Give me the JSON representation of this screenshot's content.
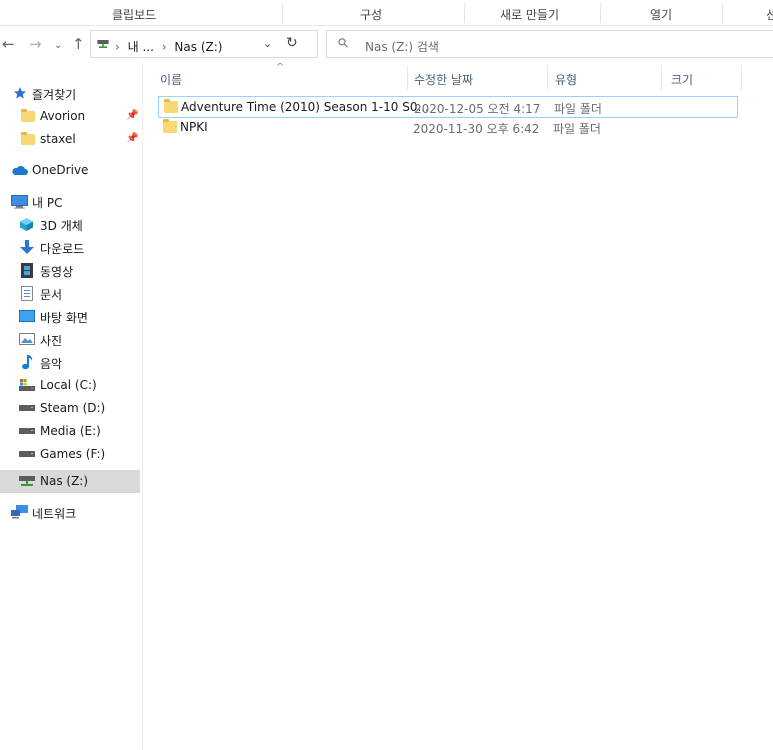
{
  "ribbon": {
    "groups": [
      "클립보드",
      "구성",
      "새로 만들기",
      "열기",
      "선택"
    ]
  },
  "address": {
    "crumbs": [
      "내 ...",
      "Nas (Z:)"
    ],
    "search_placeholder": "Nas (Z:) 검색"
  },
  "nav": {
    "quick_access": "즐겨찾기",
    "pinned": [
      "Avorion",
      "staxel"
    ],
    "onedrive": "OneDrive",
    "this_pc": "내 PC",
    "pc_items": [
      "3D 개체",
      "다운로드",
      "동영상",
      "문서",
      "바탕 화면",
      "사진",
      "음악",
      "Local (C:)",
      "Steam (D:)",
      "Media (E:)",
      "Games (F:)",
      "Nas (Z:)"
    ],
    "network": "네트워크",
    "selected": "Nas (Z:)"
  },
  "columns": {
    "name": "이름",
    "modified": "수정한 날짜",
    "type": "유형",
    "size": "크기"
  },
  "files": [
    {
      "name": "Adventure Time (2010) Season 1-10 S0...",
      "modified": "2020-12-05 오전 4:17",
      "type": "파일 폴더",
      "size": ""
    },
    {
      "name": "NPKI",
      "modified": "2020-11-30 오후 6:42",
      "type": "파일 폴더",
      "size": ""
    }
  ],
  "colors": {
    "folder": "#f8d775",
    "selected_bg": "#d9d9d9",
    "focus_border": "#99d1ff",
    "header_text": "#4c607a",
    "star": "#2b73c4"
  }
}
